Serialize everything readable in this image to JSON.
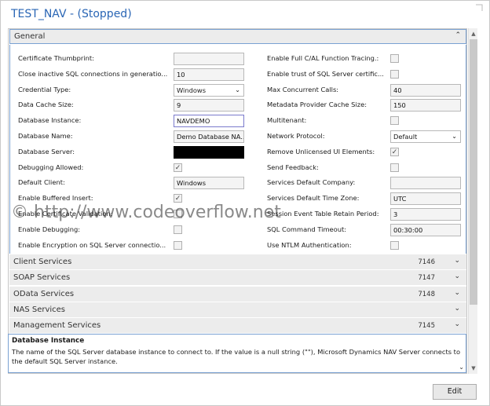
{
  "window": {
    "title": "TEST_NAV - (Stopped)"
  },
  "general": {
    "header": "General",
    "left_fields": [
      {
        "label": "Certificate Thumbprint:",
        "type": "text",
        "value": ""
      },
      {
        "label": "Close inactive SQL connections in generatio...",
        "type": "text",
        "value": "10"
      },
      {
        "label": "Credential Type:",
        "type": "select",
        "value": "Windows"
      },
      {
        "label": "Data Cache Size:",
        "type": "text",
        "value": "9"
      },
      {
        "label": "Database Instance:",
        "type": "text",
        "value": "NAVDEMO",
        "active": true
      },
      {
        "label": "Database Name:",
        "type": "text",
        "value": "Demo Database NA..."
      },
      {
        "label": "Database Server:",
        "type": "redacted",
        "value": ""
      },
      {
        "label": "Debugging Allowed:",
        "type": "check",
        "checked": true
      },
      {
        "label": "Default Client:",
        "type": "text",
        "value": "Windows"
      },
      {
        "label": "Enable Buffered Insert:",
        "type": "check",
        "checked": true
      },
      {
        "label": "Enable Certificate Validation:",
        "type": "check",
        "checked": false
      },
      {
        "label": "Enable Debugging:",
        "type": "check",
        "checked": false
      },
      {
        "label": "Enable Encryption on SQL Server connectio...",
        "type": "check",
        "checked": false
      }
    ],
    "right_fields": [
      {
        "label": "Enable Full C/AL Function Tracing.:",
        "type": "check",
        "checked": false
      },
      {
        "label": "Enable trust of SQL Server certific...",
        "type": "check",
        "checked": false
      },
      {
        "label": "Max Concurrent Calls:",
        "type": "text",
        "value": "40"
      },
      {
        "label": "Metadata Provider Cache Size:",
        "type": "text",
        "value": "150"
      },
      {
        "label": "Multitenant:",
        "type": "check",
        "checked": false
      },
      {
        "label": "Network Protocol:",
        "type": "select",
        "value": "Default"
      },
      {
        "label": "Remove Unlicensed UI Elements:",
        "type": "check",
        "checked": true
      },
      {
        "label": "Send Feedback:",
        "type": "check",
        "checked": false
      },
      {
        "label": "Services Default Company:",
        "type": "text",
        "value": ""
      },
      {
        "label": "Services Default Time Zone:",
        "type": "text",
        "value": "UTC"
      },
      {
        "label": "Session Event Table Retain Period:",
        "type": "text",
        "value": "3"
      },
      {
        "label": "SQL Command Timeout:",
        "type": "text",
        "value": "00:30:00"
      },
      {
        "label": "Use NTLM Authentication:",
        "type": "check",
        "checked": false
      }
    ]
  },
  "sections": [
    {
      "label": "Client Services",
      "count": "7146"
    },
    {
      "label": "SOAP Services",
      "count": "7147"
    },
    {
      "label": "OData Services",
      "count": "7148"
    },
    {
      "label": "NAS Services",
      "count": ""
    },
    {
      "label": "Management Services",
      "count": "7145"
    }
  ],
  "help": {
    "title": "Database Instance",
    "text": "The name of the SQL Server database instance to connect to. If the value is a null string (\"\"), Microsoft Dynamics NAV Server connects to the default SQL Server instance."
  },
  "buttons": {
    "edit": "Edit"
  },
  "watermark": "© http://www.codeoverflow.net",
  "icons": {
    "chevron_up": "chevron-up-icon",
    "chevron_down": "chevron-down-icon",
    "check": "checkmark-icon"
  }
}
